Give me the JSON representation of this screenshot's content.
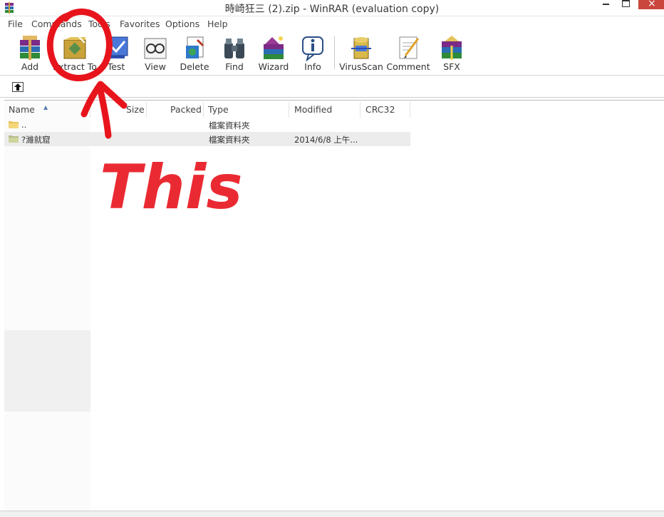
{
  "window": {
    "title": "時崎狂三 (2).zip - WinRAR (evaluation copy)"
  },
  "menu": [
    "File",
    "Commands",
    "Tools",
    "Favorites",
    "Options",
    "Help"
  ],
  "toolbar": {
    "buttons": [
      {
        "label": "Add",
        "icon": "add-archive-icon"
      },
      {
        "label": "Extract To",
        "icon": "extract-to-icon"
      },
      {
        "label": "Test",
        "icon": "test-icon"
      },
      {
        "label": "View",
        "icon": "view-icon"
      },
      {
        "label": "Delete",
        "icon": "delete-icon"
      },
      {
        "label": "Find",
        "icon": "find-icon"
      },
      {
        "label": "Wizard",
        "icon": "wizard-icon"
      },
      {
        "label": "Info",
        "icon": "info-icon"
      },
      {
        "label": "VirusScan",
        "icon": "virusscan-icon"
      },
      {
        "label": "Comment",
        "icon": "comment-icon"
      },
      {
        "label": "SFX",
        "icon": "sfx-icon"
      }
    ]
  },
  "columns": [
    "Name",
    "Size",
    "Packed",
    "Type",
    "Modified",
    "CRC32"
  ],
  "rows": [
    {
      "name": "..",
      "size": "",
      "packed": "",
      "type": "檔案資料夾",
      "modified": "",
      "crc": ""
    },
    {
      "name": "?濰就窟",
      "size": "",
      "packed": "",
      "type": "檔案資料夾",
      "modified": "2014/6/8 上午...",
      "crc": ""
    }
  ],
  "annotation": {
    "text": "This",
    "color": "#e8141c"
  },
  "colors": {
    "close_button": "#c9473d",
    "selected_row": "#ececec"
  }
}
